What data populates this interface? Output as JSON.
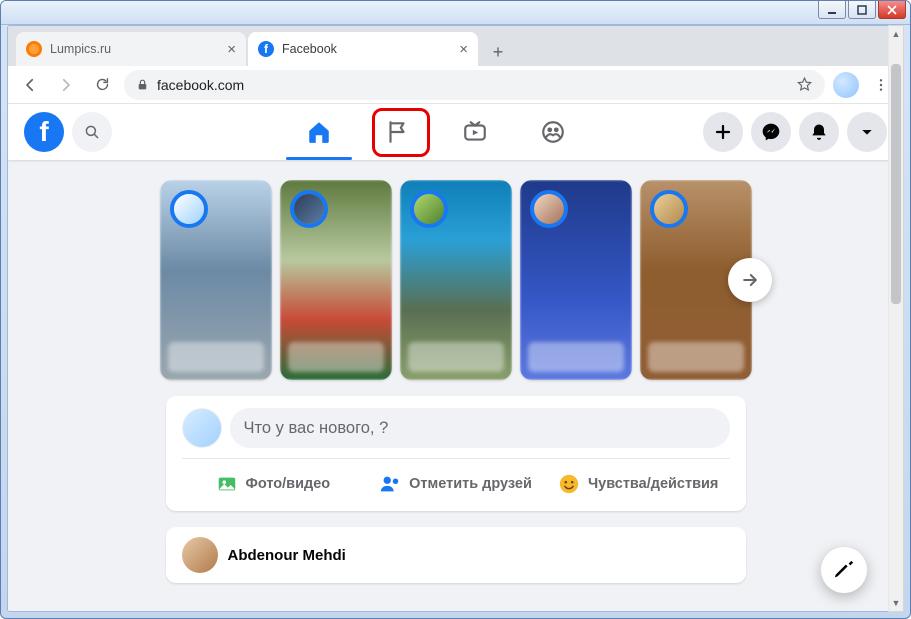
{
  "window": {
    "tabs": [
      {
        "title": "Lumpics.ru",
        "favicon": "orange-slice",
        "active": false
      },
      {
        "title": "Facebook",
        "favicon": "facebook",
        "active": true
      }
    ],
    "url_host": "facebook.com"
  },
  "fb_nav": {
    "items": [
      {
        "id": "home",
        "icon": "home-icon",
        "active": true
      },
      {
        "id": "pages",
        "icon": "flag-icon",
        "active": false,
        "highlighted": true
      },
      {
        "id": "watch",
        "icon": "watch-icon",
        "active": false
      },
      {
        "id": "groups",
        "icon": "groups-icon",
        "active": false
      }
    ],
    "right_buttons": [
      {
        "id": "create",
        "icon": "plus-icon"
      },
      {
        "id": "messenger",
        "icon": "messenger-icon"
      },
      {
        "id": "notifications",
        "icon": "bell-icon"
      },
      {
        "id": "account",
        "icon": "caret-down-icon"
      }
    ]
  },
  "stories": [
    {
      "bg": "linear-gradient(180deg,#b9d2e8 0%,#6c8aa5 45%,#9aa7b0 100%)",
      "avatar_bg": "linear-gradient(135deg,#ffffff,#9ed2ff)"
    },
    {
      "bg": "linear-gradient(180deg,#5e7a3e 0%, #b8c9a0 40%, #c74a36 70%, #2a6f3a 100%)",
      "avatar_bg": "linear-gradient(135deg,#2d3e55,#5a7ba8)"
    },
    {
      "bg": "linear-gradient(180deg,#0f7fb8 0%, #2aa0d6 30%, #5a6f52 65%, #8aa06b 100%)",
      "avatar_bg": "linear-gradient(135deg,#b0d870,#4e822d)"
    },
    {
      "bg": "linear-gradient(180deg,#1f3a8a 0%, #3557c7 60%, #5e79e0 100%)",
      "avatar_bg": "linear-gradient(135deg,#f0d7c4,#a3725a)"
    },
    {
      "bg": "linear-gradient(180deg,#b8916a 0%, #8f5e2e 45%, #915e36 100%)",
      "avatar_bg": "linear-gradient(135deg,#e9cf9a,#b38a4c)"
    }
  ],
  "composer": {
    "placeholder": "Что у вас нового,          ?",
    "actions": {
      "photo_video": "Фото/видео",
      "tag_friends": "Отметить друзей",
      "feeling": "Чувства/действия"
    }
  },
  "post": {
    "author": "Abdenour Mehdi"
  }
}
